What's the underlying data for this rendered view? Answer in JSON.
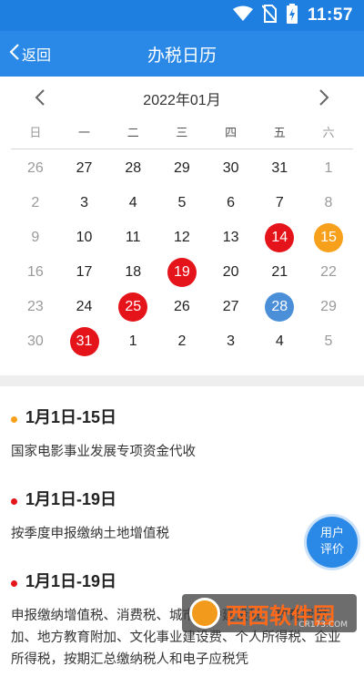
{
  "status_bar": {
    "time": "11:57",
    "icons": [
      "wifi-icon",
      "no-sim-icon",
      "battery-charging-icon"
    ]
  },
  "header": {
    "back_label": "返回",
    "title": "办税日历"
  },
  "calendar": {
    "month_label": "2022年01月",
    "weekdays": [
      "日",
      "一",
      "二",
      "三",
      "四",
      "五",
      "六"
    ],
    "weeks": [
      [
        {
          "d": "26",
          "m": 1
        },
        {
          "d": "27"
        },
        {
          "d": "28"
        },
        {
          "d": "29"
        },
        {
          "d": "30"
        },
        {
          "d": "31"
        },
        {
          "d": "1",
          "m": 1
        }
      ],
      [
        {
          "d": "2",
          "m": 1
        },
        {
          "d": "3"
        },
        {
          "d": "4"
        },
        {
          "d": "5"
        },
        {
          "d": "6"
        },
        {
          "d": "7"
        },
        {
          "d": "8",
          "m": 1
        }
      ],
      [
        {
          "d": "9",
          "m": 1
        },
        {
          "d": "10"
        },
        {
          "d": "11"
        },
        {
          "d": "12"
        },
        {
          "d": "13"
        },
        {
          "d": "14",
          "h": "red"
        },
        {
          "d": "15",
          "h": "orange"
        }
      ],
      [
        {
          "d": "16",
          "m": 1
        },
        {
          "d": "17"
        },
        {
          "d": "18"
        },
        {
          "d": "19",
          "h": "red"
        },
        {
          "d": "20"
        },
        {
          "d": "21"
        },
        {
          "d": "22",
          "m": 1
        }
      ],
      [
        {
          "d": "23",
          "m": 1
        },
        {
          "d": "24"
        },
        {
          "d": "25",
          "h": "red"
        },
        {
          "d": "26"
        },
        {
          "d": "27"
        },
        {
          "d": "28",
          "h": "blue"
        },
        {
          "d": "29",
          "m": 1
        }
      ],
      [
        {
          "d": "30",
          "m": 1
        },
        {
          "d": "31",
          "h": "red"
        },
        {
          "d": "1"
        },
        {
          "d": "2"
        },
        {
          "d": "3"
        },
        {
          "d": "4"
        },
        {
          "d": "5",
          "m": 1
        }
      ]
    ]
  },
  "events": [
    {
      "date": "1月1日-15日",
      "dot_color": "#f7a01b",
      "desc": "国家电影事业发展专项资金代收"
    },
    {
      "date": "1月1日-19日",
      "dot_color": "#e5141a",
      "desc": "按季度申报缴纳土地增值税"
    },
    {
      "date": "1月1日-19日",
      "dot_color": "#e5141a",
      "desc": "申报缴纳增值税、消费税、城市维护建设税、教育费附加、地方教育附加、文化事业建设费、个人所得税、企业所得税，按期汇总缴纳税人和电子应税凭"
    }
  ],
  "fab": {
    "line1": "用户",
    "line2": "评价"
  },
  "watermark": {
    "text": "西西软件园",
    "sub": "CR173.COM"
  },
  "colors": {
    "header": "#2a88e6",
    "status": "#1e7fe0",
    "red": "#e5141a",
    "orange": "#f7a01b",
    "blue": "#4a8fd8"
  }
}
